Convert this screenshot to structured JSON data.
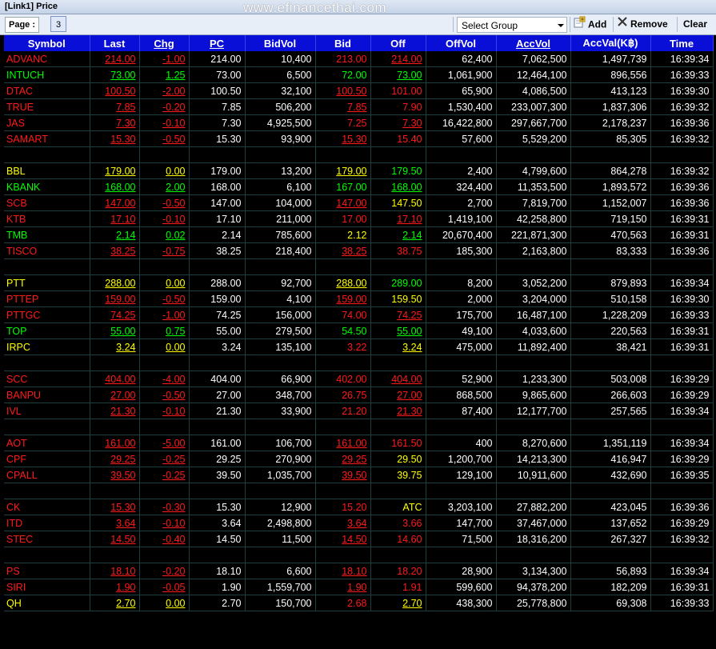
{
  "window": {
    "title": "[Link1] Price",
    "watermark": "www.efinancethai.com"
  },
  "toolbar": {
    "page_label": "Page :",
    "page_value": "3",
    "group_select": "Select Group",
    "add_label": "Add",
    "remove_label": "Remove",
    "clear_label": "Clear"
  },
  "columns": [
    "Symbol",
    "Last",
    "Chg",
    "PC",
    "BidVol",
    "Bid",
    "Off",
    "OffVol",
    "AccVol",
    "AccVal(K฿)",
    "Time"
  ],
  "colors": {
    "up": "#00ff00",
    "down": "#ff1a1a",
    "unchanged": "#ffff00",
    "neutral": "#ffffff",
    "header_bg": "#0a0fd8"
  },
  "rows": [
    {
      "sym": "ADVANC",
      "c": "red",
      "last": "214.00",
      "chg": "-1.00",
      "pc": "214.00",
      "bidvol": "10,400",
      "bid": "213.00",
      "bc": "red",
      "off": "214.00",
      "oc": "red",
      "ou": true,
      "offvol": "62,400",
      "accvol": "7,062,500",
      "accval": "1,497,739",
      "time": "16:39:34"
    },
    {
      "sym": "INTUCH",
      "c": "green",
      "last": "73.00",
      "chg": "1.25",
      "pc": "73.00",
      "bidvol": "6,500",
      "bid": "72.00",
      "bc": "green",
      "off": "73.00",
      "oc": "green",
      "ou": true,
      "offvol": "1,061,900",
      "accvol": "12,464,100",
      "accval": "896,556",
      "time": "16:39:33"
    },
    {
      "sym": "DTAC",
      "c": "red",
      "last": "100.50",
      "chg": "-2.00",
      "pc": "100.50",
      "bidvol": "32,100",
      "bid": "100.50",
      "bc": "red",
      "bu": true,
      "off": "101.00",
      "oc": "red",
      "offvol": "65,900",
      "accvol": "4,086,500",
      "accval": "413,123",
      "time": "16:39:30"
    },
    {
      "sym": "TRUE",
      "c": "red",
      "last": "7.85",
      "chg": "-0.20",
      "pc": "7.85",
      "bidvol": "506,200",
      "bid": "7.85",
      "bc": "red",
      "bu": true,
      "off": "7.90",
      "oc": "red",
      "offvol": "1,530,400",
      "accvol": "233,007,300",
      "accval": "1,837,306",
      "time": "16:39:32"
    },
    {
      "sym": "JAS",
      "c": "red",
      "last": "7.30",
      "chg": "-0.10",
      "pc": "7.30",
      "bidvol": "4,925,500",
      "bid": "7.25",
      "bc": "red",
      "off": "7.30",
      "oc": "red",
      "ou": true,
      "offvol": "16,422,800",
      "accvol": "297,667,700",
      "accval": "2,178,237",
      "time": "16:39:36"
    },
    {
      "sym": "SAMART",
      "c": "red",
      "last": "15.30",
      "chg": "-0.50",
      "pc": "15.30",
      "bidvol": "93,900",
      "bid": "15.30",
      "bc": "red",
      "bu": true,
      "off": "15.40",
      "oc": "red",
      "offvol": "57,600",
      "accvol": "5,529,200",
      "accval": "85,305",
      "time": "16:39:32"
    },
    {
      "blank": true
    },
    {
      "sym": "BBL",
      "c": "yellow",
      "last": "179.00",
      "chg": "0.00",
      "pc": "179.00",
      "bidvol": "13,200",
      "bid": "179.00",
      "bc": "yellow",
      "bu": true,
      "off": "179.50",
      "oc": "green",
      "offvol": "2,400",
      "accvol": "4,799,600",
      "accval": "864,278",
      "time": "16:39:32"
    },
    {
      "sym": "KBANK",
      "c": "green",
      "last": "168.00",
      "chg": "2.00",
      "pc": "168.00",
      "bidvol": "6,100",
      "bid": "167.00",
      "bc": "green",
      "off": "168.00",
      "oc": "green",
      "ou": true,
      "offvol": "324,400",
      "accvol": "11,353,500",
      "accval": "1,893,572",
      "time": "16:39:36"
    },
    {
      "sym": "SCB",
      "c": "red",
      "last": "147.00",
      "chg": "-0.50",
      "pc": "147.00",
      "bidvol": "104,000",
      "bid": "147.00",
      "bc": "red",
      "bu": true,
      "off": "147.50",
      "oc": "yellow",
      "offvol": "2,700",
      "accvol": "7,819,700",
      "accval": "1,152,007",
      "time": "16:39:36"
    },
    {
      "sym": "KTB",
      "c": "red",
      "last": "17.10",
      "chg": "-0.10",
      "pc": "17.10",
      "bidvol": "211,000",
      "bid": "17.00",
      "bc": "red",
      "off": "17.10",
      "oc": "red",
      "ou": true,
      "offvol": "1,419,100",
      "accvol": "42,258,800",
      "accval": "719,150",
      "time": "16:39:31"
    },
    {
      "sym": "TMB",
      "c": "green",
      "last": "2.14",
      "chg": "0.02",
      "pc": "2.14",
      "bidvol": "785,600",
      "bid": "2.12",
      "bc": "yellow",
      "off": "2.14",
      "oc": "green",
      "ou": true,
      "offvol": "20,670,400",
      "accvol": "221,871,300",
      "accval": "470,563",
      "time": "16:39:31"
    },
    {
      "sym": "TISCO",
      "c": "red",
      "last": "38.25",
      "chg": "-0.75",
      "pc": "38.25",
      "bidvol": "218,400",
      "bid": "38.25",
      "bc": "red",
      "bu": true,
      "off": "38.75",
      "oc": "red",
      "offvol": "185,300",
      "accvol": "2,163,800",
      "accval": "83,333",
      "time": "16:39:36"
    },
    {
      "blank": true
    },
    {
      "sym": "PTT",
      "c": "yellow",
      "last": "288.00",
      "chg": "0.00",
      "pc": "288.00",
      "bidvol": "92,700",
      "bid": "288.00",
      "bc": "yellow",
      "bu": true,
      "off": "289.00",
      "oc": "green",
      "offvol": "8,200",
      "accvol": "3,052,200",
      "accval": "879,893",
      "time": "16:39:34"
    },
    {
      "sym": "PTTEP",
      "c": "red",
      "last": "159.00",
      "chg": "-0.50",
      "pc": "159.00",
      "bidvol": "4,100",
      "bid": "159.00",
      "bc": "red",
      "bu": true,
      "off": "159.50",
      "oc": "yellow",
      "offvol": "2,000",
      "accvol": "3,204,000",
      "accval": "510,158",
      "time": "16:39:30"
    },
    {
      "sym": "PTTGC",
      "c": "red",
      "last": "74.25",
      "chg": "-1.00",
      "pc": "74.25",
      "bidvol": "156,000",
      "bid": "74.00",
      "bc": "red",
      "off": "74.25",
      "oc": "red",
      "ou": true,
      "offvol": "175,700",
      "accvol": "16,487,100",
      "accval": "1,228,209",
      "time": "16:39:33"
    },
    {
      "sym": "TOP",
      "c": "green",
      "last": "55.00",
      "chg": "0.75",
      "pc": "55.00",
      "bidvol": "279,500",
      "bid": "54.50",
      "bc": "green",
      "off": "55.00",
      "oc": "green",
      "ou": true,
      "offvol": "49,100",
      "accvol": "4,033,600",
      "accval": "220,563",
      "time": "16:39:31"
    },
    {
      "sym": "IRPC",
      "c": "yellow",
      "last": "3.24",
      "chg": "0.00",
      "pc": "3.24",
      "bidvol": "135,100",
      "bid": "3.22",
      "bc": "red",
      "off": "3.24",
      "oc": "yellow",
      "ou": true,
      "offvol": "475,000",
      "accvol": "11,892,400",
      "accval": "38,421",
      "time": "16:39:31"
    },
    {
      "blank": true
    },
    {
      "sym": "SCC",
      "c": "red",
      "last": "404.00",
      "chg": "-4.00",
      "pc": "404.00",
      "bidvol": "66,900",
      "bid": "402.00",
      "bc": "red",
      "off": "404.00",
      "oc": "red",
      "ou": true,
      "offvol": "52,900",
      "accvol": "1,233,300",
      "accval": "503,008",
      "time": "16:39:29"
    },
    {
      "sym": "BANPU",
      "c": "red",
      "last": "27.00",
      "chg": "-0.50",
      "pc": "27.00",
      "bidvol": "348,700",
      "bid": "26.75",
      "bc": "red",
      "off": "27.00",
      "oc": "red",
      "ou": true,
      "offvol": "868,500",
      "accvol": "9,865,600",
      "accval": "266,603",
      "time": "16:39:29"
    },
    {
      "sym": "IVL",
      "c": "red",
      "last": "21.30",
      "chg": "-0.10",
      "pc": "21.30",
      "bidvol": "33,900",
      "bid": "21.20",
      "bc": "red",
      "off": "21.30",
      "oc": "red",
      "ou": true,
      "offvol": "87,400",
      "accvol": "12,177,700",
      "accval": "257,565",
      "time": "16:39:34"
    },
    {
      "blank": true
    },
    {
      "sym": "AOT",
      "c": "red",
      "last": "161.00",
      "chg": "-5.00",
      "pc": "161.00",
      "bidvol": "106,700",
      "bid": "161.00",
      "bc": "red",
      "bu": true,
      "off": "161.50",
      "oc": "red",
      "offvol": "400",
      "accvol": "8,270,600",
      "accval": "1,351,119",
      "time": "16:39:34"
    },
    {
      "sym": "CPF",
      "c": "red",
      "last": "29.25",
      "chg": "-0.25",
      "pc": "29.25",
      "bidvol": "270,900",
      "bid": "29.25",
      "bc": "red",
      "bu": true,
      "off": "29.50",
      "oc": "yellow",
      "offvol": "1,200,700",
      "accvol": "14,213,300",
      "accval": "416,947",
      "time": "16:39:29"
    },
    {
      "sym": "CPALL",
      "c": "red",
      "last": "39.50",
      "chg": "-0.25",
      "pc": "39.50",
      "bidvol": "1,035,700",
      "bid": "39.50",
      "bc": "red",
      "bu": true,
      "off": "39.75",
      "oc": "yellow",
      "offvol": "129,100",
      "accvol": "10,911,600",
      "accval": "432,690",
      "time": "16:39:35"
    },
    {
      "blank": true
    },
    {
      "sym": "CK",
      "c": "red",
      "last": "15.30",
      "chg": "-0.30",
      "pc": "15.30",
      "bidvol": "12,900",
      "bid": "15.20",
      "bc": "red",
      "off": "ATC",
      "oc": "yellow",
      "offvol": "3,203,100",
      "accvol": "27,882,200",
      "accval": "423,045",
      "time": "16:39:36"
    },
    {
      "sym": "ITD",
      "c": "red",
      "last": "3.64",
      "chg": "-0.10",
      "pc": "3.64",
      "bidvol": "2,498,800",
      "bid": "3.64",
      "bc": "red",
      "bu": true,
      "off": "3.66",
      "oc": "red",
      "offvol": "147,700",
      "accvol": "37,467,000",
      "accval": "137,652",
      "time": "16:39:29"
    },
    {
      "sym": "STEC",
      "c": "red",
      "last": "14.50",
      "chg": "-0.40",
      "pc": "14.50",
      "bidvol": "11,500",
      "bid": "14.50",
      "bc": "red",
      "bu": true,
      "off": "14.60",
      "oc": "red",
      "offvol": "71,500",
      "accvol": "18,316,200",
      "accval": "267,327",
      "time": "16:39:32"
    },
    {
      "blank": true
    },
    {
      "sym": "PS",
      "c": "red",
      "last": "18.10",
      "chg": "-0.20",
      "pc": "18.10",
      "bidvol": "6,600",
      "bid": "18.10",
      "bc": "red",
      "bu": true,
      "off": "18.20",
      "oc": "red",
      "offvol": "28,900",
      "accvol": "3,134,300",
      "accval": "56,893",
      "time": "16:39:34"
    },
    {
      "sym": "SIRI",
      "c": "red",
      "last": "1.90",
      "chg": "-0.05",
      "pc": "1.90",
      "bidvol": "1,559,700",
      "bid": "1.90",
      "bc": "red",
      "bu": true,
      "off": "1.91",
      "oc": "red",
      "offvol": "599,600",
      "accvol": "94,378,200",
      "accval": "182,209",
      "time": "16:39:31"
    },
    {
      "sym": "QH",
      "c": "yellow",
      "last": "2.70",
      "chg": "0.00",
      "pc": "2.70",
      "bidvol": "150,700",
      "bid": "2.68",
      "bc": "red",
      "off": "2.70",
      "oc": "yellow",
      "ou": true,
      "offvol": "438,300",
      "accvol": "25,778,800",
      "accval": "69,308",
      "time": "16:39:33"
    }
  ]
}
